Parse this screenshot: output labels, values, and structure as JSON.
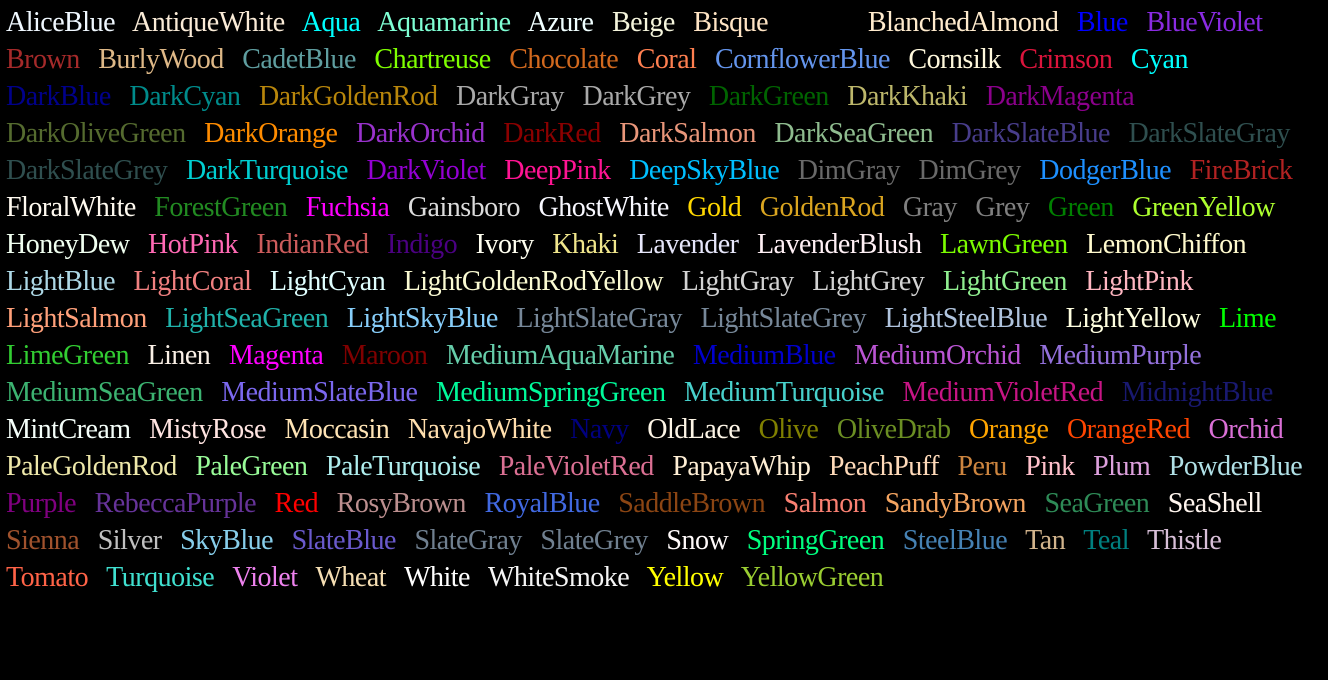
{
  "colors": [
    {
      "name": "AliceBlue",
      "hex": "#F0F8FF"
    },
    {
      "name": "AntiqueWhite",
      "hex": "#FAEBD7"
    },
    {
      "name": "Aqua",
      "hex": "#00FFFF"
    },
    {
      "name": "Aquamarine",
      "hex": "#7FFFD4"
    },
    {
      "name": "Azure",
      "hex": "#F0FFFF"
    },
    {
      "name": "Beige",
      "hex": "#F5F5DC"
    },
    {
      "name": "Bisque",
      "hex": "#FFE4C4"
    },
    {
      "name": "Black",
      "hex": "#000000"
    },
    {
      "name": "BlanchedAlmond",
      "hex": "#FFEBCD"
    },
    {
      "name": "Blue",
      "hex": "#0000FF"
    },
    {
      "name": "BlueViolet",
      "hex": "#8A2BE2"
    },
    {
      "name": "Brown",
      "hex": "#A52A2A"
    },
    {
      "name": "BurlyWood",
      "hex": "#DEB887"
    },
    {
      "name": "CadetBlue",
      "hex": "#5F9EA0"
    },
    {
      "name": "Chartreuse",
      "hex": "#7FFF00"
    },
    {
      "name": "Chocolate",
      "hex": "#D2691E"
    },
    {
      "name": "Coral",
      "hex": "#FF7F50"
    },
    {
      "name": "CornflowerBlue",
      "hex": "#6495ED"
    },
    {
      "name": "Cornsilk",
      "hex": "#FFF8DC"
    },
    {
      "name": "Crimson",
      "hex": "#DC143C"
    },
    {
      "name": "Cyan",
      "hex": "#00FFFF"
    },
    {
      "name": "DarkBlue",
      "hex": "#00008B"
    },
    {
      "name": "DarkCyan",
      "hex": "#008B8B"
    },
    {
      "name": "DarkGoldenRod",
      "hex": "#B8860B"
    },
    {
      "name": "DarkGray",
      "hex": "#A9A9A9"
    },
    {
      "name": "DarkGrey",
      "hex": "#A9A9A9"
    },
    {
      "name": "DarkGreen",
      "hex": "#006400"
    },
    {
      "name": "DarkKhaki",
      "hex": "#BDB76B"
    },
    {
      "name": "DarkMagenta",
      "hex": "#8B008B"
    },
    {
      "name": "DarkOliveGreen",
      "hex": "#556B2F"
    },
    {
      "name": "DarkOrange",
      "hex": "#FF8C00"
    },
    {
      "name": "DarkOrchid",
      "hex": "#9932CC"
    },
    {
      "name": "DarkRed",
      "hex": "#8B0000"
    },
    {
      "name": "DarkSalmon",
      "hex": "#E9967A"
    },
    {
      "name": "DarkSeaGreen",
      "hex": "#8FBC8F"
    },
    {
      "name": "DarkSlateBlue",
      "hex": "#483D8B"
    },
    {
      "name": "DarkSlateGray",
      "hex": "#2F4F4F"
    },
    {
      "name": "DarkSlateGrey",
      "hex": "#2F4F4F"
    },
    {
      "name": "DarkTurquoise",
      "hex": "#00CED1"
    },
    {
      "name": "DarkViolet",
      "hex": "#9400D3"
    },
    {
      "name": "DeepPink",
      "hex": "#FF1493"
    },
    {
      "name": "DeepSkyBlue",
      "hex": "#00BFFF"
    },
    {
      "name": "DimGray",
      "hex": "#696969"
    },
    {
      "name": "DimGrey",
      "hex": "#696969"
    },
    {
      "name": "DodgerBlue",
      "hex": "#1E90FF"
    },
    {
      "name": "FireBrick",
      "hex": "#B22222"
    },
    {
      "name": "FloralWhite",
      "hex": "#FFFAF0"
    },
    {
      "name": "ForestGreen",
      "hex": "#228B22"
    },
    {
      "name": "Fuchsia",
      "hex": "#FF00FF"
    },
    {
      "name": "Gainsboro",
      "hex": "#DCDCDC"
    },
    {
      "name": "GhostWhite",
      "hex": "#F8F8FF"
    },
    {
      "name": "Gold",
      "hex": "#FFD700"
    },
    {
      "name": "GoldenRod",
      "hex": "#DAA520"
    },
    {
      "name": "Gray",
      "hex": "#808080"
    },
    {
      "name": "Grey",
      "hex": "#808080"
    },
    {
      "name": "Green",
      "hex": "#008000"
    },
    {
      "name": "GreenYellow",
      "hex": "#ADFF2F"
    },
    {
      "name": "HoneyDew",
      "hex": "#F0FFF0"
    },
    {
      "name": "HotPink",
      "hex": "#FF69B4"
    },
    {
      "name": "IndianRed",
      "hex": "#CD5C5C"
    },
    {
      "name": "Indigo",
      "hex": "#4B0082"
    },
    {
      "name": "Ivory",
      "hex": "#FFFFF0"
    },
    {
      "name": "Khaki",
      "hex": "#F0E68C"
    },
    {
      "name": "Lavender",
      "hex": "#E6E6FA"
    },
    {
      "name": "LavenderBlush",
      "hex": "#FFF0F5"
    },
    {
      "name": "LawnGreen",
      "hex": "#7CFC00"
    },
    {
      "name": "LemonChiffon",
      "hex": "#FFFACD"
    },
    {
      "name": "LightBlue",
      "hex": "#ADD8E6"
    },
    {
      "name": "LightCoral",
      "hex": "#F08080"
    },
    {
      "name": "LightCyan",
      "hex": "#E0FFFF"
    },
    {
      "name": "LightGoldenRodYellow",
      "hex": "#FAFAD2"
    },
    {
      "name": "LightGray",
      "hex": "#D3D3D3"
    },
    {
      "name": "LightGrey",
      "hex": "#D3D3D3"
    },
    {
      "name": "LightGreen",
      "hex": "#90EE90"
    },
    {
      "name": "LightPink",
      "hex": "#FFB6C1"
    },
    {
      "name": "LightSalmon",
      "hex": "#FFA07A"
    },
    {
      "name": "LightSeaGreen",
      "hex": "#20B2AA"
    },
    {
      "name": "LightSkyBlue",
      "hex": "#87CEFA"
    },
    {
      "name": "LightSlateGray",
      "hex": "#778899"
    },
    {
      "name": "LightSlateGrey",
      "hex": "#778899"
    },
    {
      "name": "LightSteelBlue",
      "hex": "#B0C4DE"
    },
    {
      "name": "LightYellow",
      "hex": "#FFFFE0"
    },
    {
      "name": "Lime",
      "hex": "#00FF00"
    },
    {
      "name": "LimeGreen",
      "hex": "#32CD32"
    },
    {
      "name": "Linen",
      "hex": "#FAF0E6"
    },
    {
      "name": "Magenta",
      "hex": "#FF00FF"
    },
    {
      "name": "Maroon",
      "hex": "#800000"
    },
    {
      "name": "MediumAquaMarine",
      "hex": "#66CDAA"
    },
    {
      "name": "MediumBlue",
      "hex": "#0000CD"
    },
    {
      "name": "MediumOrchid",
      "hex": "#BA55D3"
    },
    {
      "name": "MediumPurple",
      "hex": "#9370DB"
    },
    {
      "name": "MediumSeaGreen",
      "hex": "#3CB371"
    },
    {
      "name": "MediumSlateBlue",
      "hex": "#7B68EE"
    },
    {
      "name": "MediumSpringGreen",
      "hex": "#00FA9A"
    },
    {
      "name": "MediumTurquoise",
      "hex": "#48D1CC"
    },
    {
      "name": "MediumVioletRed",
      "hex": "#C71585"
    },
    {
      "name": "MidnightBlue",
      "hex": "#191970"
    },
    {
      "name": "MintCream",
      "hex": "#F5FFFA"
    },
    {
      "name": "MistyRose",
      "hex": "#FFE4E1"
    },
    {
      "name": "Moccasin",
      "hex": "#FFE4B5"
    },
    {
      "name": "NavajoWhite",
      "hex": "#FFDEAD"
    },
    {
      "name": "Navy",
      "hex": "#000080"
    },
    {
      "name": "OldLace",
      "hex": "#FDF5E6"
    },
    {
      "name": "Olive",
      "hex": "#808000"
    },
    {
      "name": "OliveDrab",
      "hex": "#6B8E23"
    },
    {
      "name": "Orange",
      "hex": "#FFA500"
    },
    {
      "name": "OrangeRed",
      "hex": "#FF4500"
    },
    {
      "name": "Orchid",
      "hex": "#DA70D6"
    },
    {
      "name": "PaleGoldenRod",
      "hex": "#EEE8AA"
    },
    {
      "name": "PaleGreen",
      "hex": "#98FB98"
    },
    {
      "name": "PaleTurquoise",
      "hex": "#AFEEEE"
    },
    {
      "name": "PaleVioletRed",
      "hex": "#DB7093"
    },
    {
      "name": "PapayaWhip",
      "hex": "#FFEFD5"
    },
    {
      "name": "PeachPuff",
      "hex": "#FFDAB9"
    },
    {
      "name": "Peru",
      "hex": "#CD853F"
    },
    {
      "name": "Pink",
      "hex": "#FFC0CB"
    },
    {
      "name": "Plum",
      "hex": "#DDA0DD"
    },
    {
      "name": "PowderBlue",
      "hex": "#B0E0E6"
    },
    {
      "name": "Purple",
      "hex": "#800080"
    },
    {
      "name": "RebeccaPurple",
      "hex": "#663399"
    },
    {
      "name": "Red",
      "hex": "#FF0000"
    },
    {
      "name": "RosyBrown",
      "hex": "#BC8F8F"
    },
    {
      "name": "RoyalBlue",
      "hex": "#4169E1"
    },
    {
      "name": "SaddleBrown",
      "hex": "#8B4513"
    },
    {
      "name": "Salmon",
      "hex": "#FA8072"
    },
    {
      "name": "SandyBrown",
      "hex": "#F4A460"
    },
    {
      "name": "SeaGreen",
      "hex": "#2E8B57"
    },
    {
      "name": "SeaShell",
      "hex": "#FFF5EE"
    },
    {
      "name": "Sienna",
      "hex": "#A0522D"
    },
    {
      "name": "Silver",
      "hex": "#C0C0C0"
    },
    {
      "name": "SkyBlue",
      "hex": "#87CEEB"
    },
    {
      "name": "SlateBlue",
      "hex": "#6A5ACD"
    },
    {
      "name": "SlateGray",
      "hex": "#708090"
    },
    {
      "name": "SlateGrey",
      "hex": "#708090"
    },
    {
      "name": "Snow",
      "hex": "#FFFAFA"
    },
    {
      "name": "SpringGreen",
      "hex": "#00FF7F"
    },
    {
      "name": "SteelBlue",
      "hex": "#4682B4"
    },
    {
      "name": "Tan",
      "hex": "#D2B48C"
    },
    {
      "name": "Teal",
      "hex": "#008080"
    },
    {
      "name": "Thistle",
      "hex": "#D8BFD8"
    },
    {
      "name": "Tomato",
      "hex": "#FF6347"
    },
    {
      "name": "Turquoise",
      "hex": "#40E0D0"
    },
    {
      "name": "Violet",
      "hex": "#EE82EE"
    },
    {
      "name": "Wheat",
      "hex": "#F5DEB3"
    },
    {
      "name": "White",
      "hex": "#FFFFFF"
    },
    {
      "name": "WhiteSmoke",
      "hex": "#F5F5F5"
    },
    {
      "name": "Yellow",
      "hex": "#FFFF00"
    },
    {
      "name": "YellowGreen",
      "hex": "#9ACD32"
    }
  ]
}
